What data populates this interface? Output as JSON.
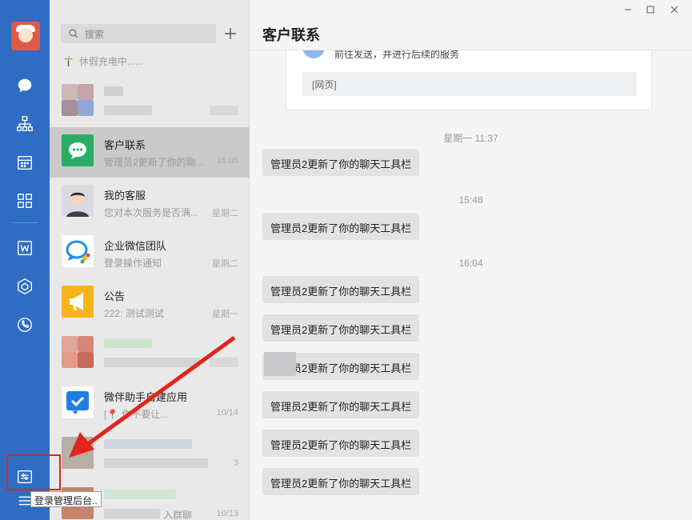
{
  "sidebar": {
    "avatar_label": "user-avatar",
    "icons": [
      "chat-icon",
      "org-chart-icon",
      "calendar-icon",
      "apps-grid-icon",
      "docs-icon",
      "hexagon-app-icon",
      "phone-icon",
      "admin-console-icon",
      "menu-icon"
    ],
    "admin_tooltip": "登录管理后台.."
  },
  "list": {
    "search_placeholder": "搜索",
    "status_text": "休假充电中......",
    "conversations": [
      {
        "name": "",
        "preview": "",
        "time": "",
        "blurred": true
      },
      {
        "name": "客户联系",
        "preview": "管理员2更新了你的聊...",
        "time": "16:05",
        "selected": true
      },
      {
        "name": "我的客服",
        "preview": "您对本次服务是否满...",
        "time": "星期二"
      },
      {
        "name": "企业微信团队",
        "preview": "登录操作通知",
        "time": "星期二"
      },
      {
        "name": "公告",
        "preview": "222: 测试测试",
        "time": "星期一"
      },
      {
        "name": "",
        "preview": "",
        "time": "",
        "blurred": true
      },
      {
        "name": "微伴助手自建应用",
        "preview": "你不要让...",
        "time": "10/14"
      },
      {
        "name": "",
        "preview": "",
        "time": "3",
        "blurred": true
      },
      {
        "name": "",
        "preview": "入群聊",
        "time": "10/13",
        "blurred": true
      }
    ]
  },
  "chat": {
    "title": "客户联系",
    "card_text": "前往发送，并进行后续的服务",
    "card_link": "[网页]",
    "timestamps": [
      "星期一 11:37",
      "15:48",
      "16:04"
    ],
    "message_text": "管理员2更新了你的聊天工具栏"
  },
  "colors": {
    "rail": "#2f6cc4",
    "highlight_box": "#e1251b",
    "wechat_green": "#2aae67",
    "announce_orange": "#f8b51b"
  }
}
